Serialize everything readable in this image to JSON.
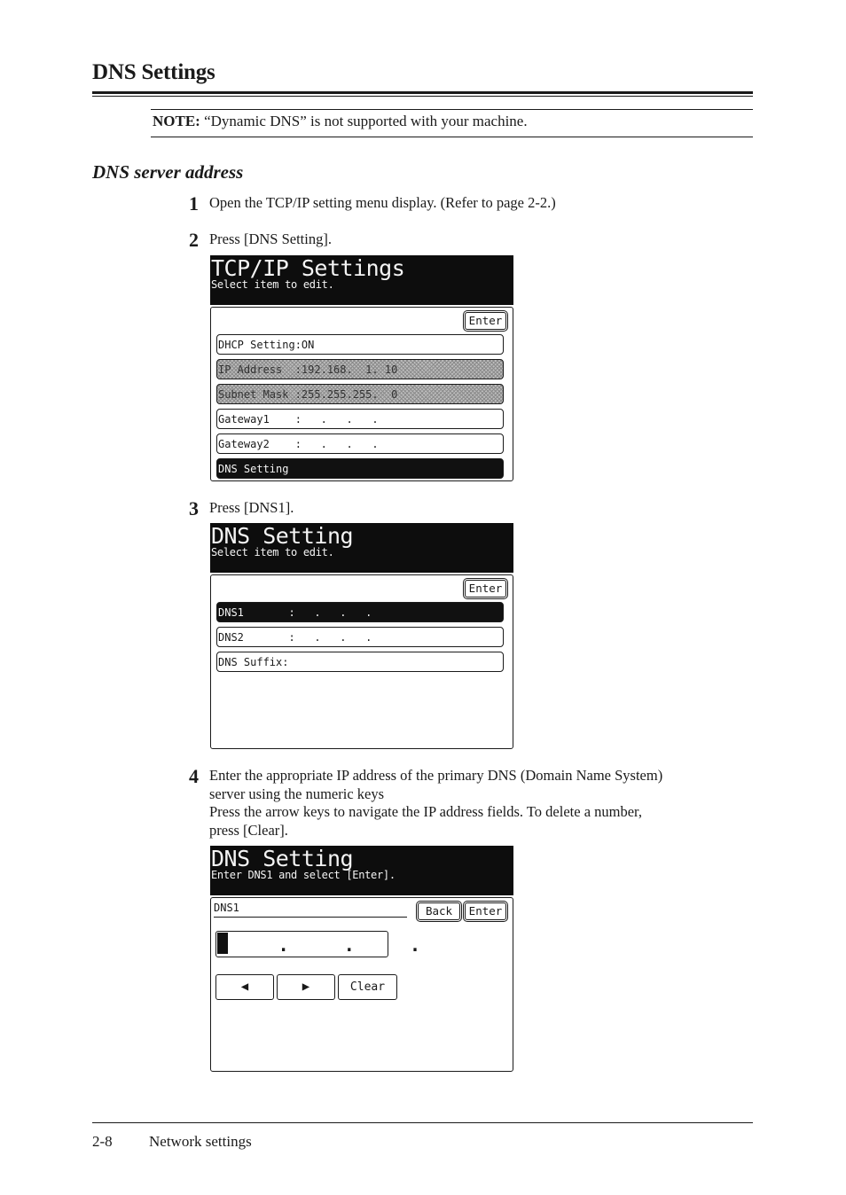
{
  "page": {
    "title": "DNS Settings",
    "note_label": "NOTE:",
    "note_text": " “Dynamic DNS” is not supported with your machine.",
    "section_title": "DNS server address",
    "footer": {
      "page_number": "2-8",
      "section": "Network settings"
    }
  },
  "steps": [
    {
      "number": "1",
      "text": "Open the TCP/IP setting menu display. (Refer to page 2-2.)"
    },
    {
      "number": "2",
      "text": "Press [DNS Setting]."
    },
    {
      "number": "3",
      "text": "Press [DNS1]."
    },
    {
      "number": "4",
      "lines": [
        "Enter the appropriate IP address of the primary DNS (Domain Name System)",
        "server using the numeric keys",
        "Press the arrow keys to navigate the IP address fields. To delete a number,",
        "press [Clear]."
      ]
    }
  ],
  "screens": {
    "tcpip": {
      "title": "TCP/IP Settings",
      "subtitle": "Select item to edit.",
      "enter_label": "Enter",
      "items": [
        {
          "label": "DHCP Setting:ON",
          "state": "normal"
        },
        {
          "label": "IP Address  :192.168.  1. 10",
          "state": "disabled"
        },
        {
          "label": "Subnet Mask :255.255.255.  0",
          "state": "disabled"
        },
        {
          "label": "Gateway1    :   .   .   .",
          "state": "normal"
        },
        {
          "label": "Gateway2    :   .   .   .",
          "state": "normal"
        },
        {
          "label": "DNS Setting",
          "state": "selected"
        }
      ]
    },
    "dns_list": {
      "title": "DNS Setting",
      "subtitle": "Select item to edit.",
      "enter_label": "Enter",
      "items": [
        {
          "label": "DNS1       :   .   .   .",
          "state": "selected"
        },
        {
          "label": "DNS2       :   .   .   .",
          "state": "normal"
        },
        {
          "label": "DNS Suffix:",
          "state": "normal"
        }
      ]
    },
    "dns_entry": {
      "title": "DNS Setting",
      "subtitle": "Enter DNS1 and select [Enter].",
      "field_label": "DNS1",
      "back_label": "Back",
      "enter_label": "Enter",
      "ip_value": "   .   .   .",
      "left_arrow": "◀",
      "right_arrow": "▶",
      "clear_label": "Clear"
    }
  }
}
